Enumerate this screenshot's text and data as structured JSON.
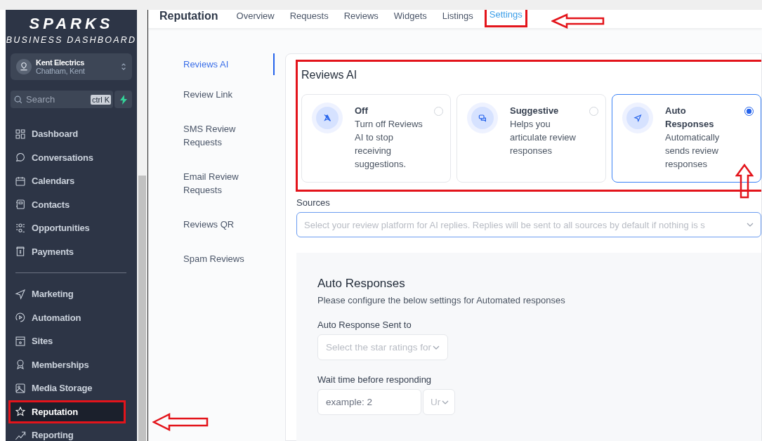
{
  "brand": {
    "name": "SPARKS",
    "tagline": "BUSINESS DASHBOARD"
  },
  "account": {
    "name": "Kent Electrics",
    "location": "Chatham, Kent"
  },
  "search": {
    "placeholder": "Search",
    "shortcut": "ctrl K"
  },
  "sidebar": {
    "groups": [
      {
        "items": [
          {
            "label": "Dashboard",
            "selected": false
          },
          {
            "label": "Conversations",
            "selected": false
          },
          {
            "label": "Calendars",
            "selected": false
          },
          {
            "label": "Contacts",
            "selected": false
          },
          {
            "label": "Opportunities",
            "selected": false
          },
          {
            "label": "Payments",
            "selected": false
          }
        ]
      },
      {
        "items": [
          {
            "label": "Marketing",
            "selected": false
          },
          {
            "label": "Automation",
            "selected": false
          },
          {
            "label": "Sites",
            "selected": false
          },
          {
            "label": "Memberships",
            "selected": false
          },
          {
            "label": "Media Storage",
            "selected": false
          },
          {
            "label": "Reputation",
            "selected": true
          },
          {
            "label": "Reporting",
            "selected": false
          }
        ]
      }
    ]
  },
  "page_title": "Reputation",
  "tabs": [
    {
      "label": "Overview",
      "selected": false
    },
    {
      "label": "Requests",
      "selected": false
    },
    {
      "label": "Reviews",
      "selected": false
    },
    {
      "label": "Widgets",
      "selected": false
    },
    {
      "label": "Listings",
      "selected": false
    },
    {
      "label": "Settings",
      "selected": true
    }
  ],
  "settings_nav": [
    {
      "label": "Reviews AI",
      "selected": true
    },
    {
      "label": "Review Link",
      "selected": false
    },
    {
      "label": "SMS Review Requests",
      "selected": false
    },
    {
      "label": "Email Review Requests",
      "selected": false
    },
    {
      "label": "Reviews QR",
      "selected": false
    },
    {
      "label": "Spam Reviews",
      "selected": false
    }
  ],
  "reviews_ai": {
    "title": "Reviews AI",
    "options": [
      {
        "title": "Off",
        "description": "Turn off Reviews AI to stop receiving suggestions.",
        "selected": false
      },
      {
        "title": "Suggestive",
        "description": "Helps you articulate review responses",
        "selected": false
      },
      {
        "title": "Auto Responses",
        "description": "Automatically sends review responses",
        "selected": true
      }
    ]
  },
  "sources": {
    "label": "Sources",
    "placeholder": "Select your review platform for AI replies. Replies will be sent to all sources by default if nothing is s"
  },
  "auto_responses": {
    "title": "Auto Responses",
    "description": "Please configure the below settings for Automated responses",
    "sent_to": {
      "label": "Auto Response Sent to",
      "placeholder": "Select the star ratings for"
    },
    "wait_time": {
      "label": "Wait time before responding",
      "placeholder": "example: 2",
      "unit_placeholder": "Ur"
    }
  }
}
